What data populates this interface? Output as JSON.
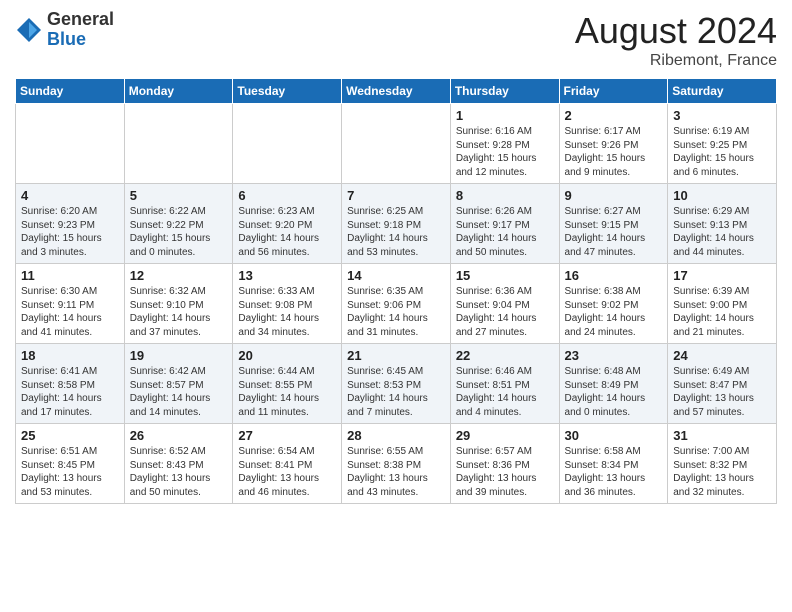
{
  "header": {
    "logo_general": "General",
    "logo_blue": "Blue",
    "month_title": "August 2024",
    "location": "Ribemont, France"
  },
  "weekdays": [
    "Sunday",
    "Monday",
    "Tuesday",
    "Wednesday",
    "Thursday",
    "Friday",
    "Saturday"
  ],
  "weeks": [
    [
      {
        "day": "",
        "info": ""
      },
      {
        "day": "",
        "info": ""
      },
      {
        "day": "",
        "info": ""
      },
      {
        "day": "",
        "info": ""
      },
      {
        "day": "1",
        "info": "Sunrise: 6:16 AM\nSunset: 9:28 PM\nDaylight: 15 hours\nand 12 minutes."
      },
      {
        "day": "2",
        "info": "Sunrise: 6:17 AM\nSunset: 9:26 PM\nDaylight: 15 hours\nand 9 minutes."
      },
      {
        "day": "3",
        "info": "Sunrise: 6:19 AM\nSunset: 9:25 PM\nDaylight: 15 hours\nand 6 minutes."
      }
    ],
    [
      {
        "day": "4",
        "info": "Sunrise: 6:20 AM\nSunset: 9:23 PM\nDaylight: 15 hours\nand 3 minutes."
      },
      {
        "day": "5",
        "info": "Sunrise: 6:22 AM\nSunset: 9:22 PM\nDaylight: 15 hours\nand 0 minutes."
      },
      {
        "day": "6",
        "info": "Sunrise: 6:23 AM\nSunset: 9:20 PM\nDaylight: 14 hours\nand 56 minutes."
      },
      {
        "day": "7",
        "info": "Sunrise: 6:25 AM\nSunset: 9:18 PM\nDaylight: 14 hours\nand 53 minutes."
      },
      {
        "day": "8",
        "info": "Sunrise: 6:26 AM\nSunset: 9:17 PM\nDaylight: 14 hours\nand 50 minutes."
      },
      {
        "day": "9",
        "info": "Sunrise: 6:27 AM\nSunset: 9:15 PM\nDaylight: 14 hours\nand 47 minutes."
      },
      {
        "day": "10",
        "info": "Sunrise: 6:29 AM\nSunset: 9:13 PM\nDaylight: 14 hours\nand 44 minutes."
      }
    ],
    [
      {
        "day": "11",
        "info": "Sunrise: 6:30 AM\nSunset: 9:11 PM\nDaylight: 14 hours\nand 41 minutes."
      },
      {
        "day": "12",
        "info": "Sunrise: 6:32 AM\nSunset: 9:10 PM\nDaylight: 14 hours\nand 37 minutes."
      },
      {
        "day": "13",
        "info": "Sunrise: 6:33 AM\nSunset: 9:08 PM\nDaylight: 14 hours\nand 34 minutes."
      },
      {
        "day": "14",
        "info": "Sunrise: 6:35 AM\nSunset: 9:06 PM\nDaylight: 14 hours\nand 31 minutes."
      },
      {
        "day": "15",
        "info": "Sunrise: 6:36 AM\nSunset: 9:04 PM\nDaylight: 14 hours\nand 27 minutes."
      },
      {
        "day": "16",
        "info": "Sunrise: 6:38 AM\nSunset: 9:02 PM\nDaylight: 14 hours\nand 24 minutes."
      },
      {
        "day": "17",
        "info": "Sunrise: 6:39 AM\nSunset: 9:00 PM\nDaylight: 14 hours\nand 21 minutes."
      }
    ],
    [
      {
        "day": "18",
        "info": "Sunrise: 6:41 AM\nSunset: 8:58 PM\nDaylight: 14 hours\nand 17 minutes."
      },
      {
        "day": "19",
        "info": "Sunrise: 6:42 AM\nSunset: 8:57 PM\nDaylight: 14 hours\nand 14 minutes."
      },
      {
        "day": "20",
        "info": "Sunrise: 6:44 AM\nSunset: 8:55 PM\nDaylight: 14 hours\nand 11 minutes."
      },
      {
        "day": "21",
        "info": "Sunrise: 6:45 AM\nSunset: 8:53 PM\nDaylight: 14 hours\nand 7 minutes."
      },
      {
        "day": "22",
        "info": "Sunrise: 6:46 AM\nSunset: 8:51 PM\nDaylight: 14 hours\nand 4 minutes."
      },
      {
        "day": "23",
        "info": "Sunrise: 6:48 AM\nSunset: 8:49 PM\nDaylight: 14 hours\nand 0 minutes."
      },
      {
        "day": "24",
        "info": "Sunrise: 6:49 AM\nSunset: 8:47 PM\nDaylight: 13 hours\nand 57 minutes."
      }
    ],
    [
      {
        "day": "25",
        "info": "Sunrise: 6:51 AM\nSunset: 8:45 PM\nDaylight: 13 hours\nand 53 minutes."
      },
      {
        "day": "26",
        "info": "Sunrise: 6:52 AM\nSunset: 8:43 PM\nDaylight: 13 hours\nand 50 minutes."
      },
      {
        "day": "27",
        "info": "Sunrise: 6:54 AM\nSunset: 8:41 PM\nDaylight: 13 hours\nand 46 minutes."
      },
      {
        "day": "28",
        "info": "Sunrise: 6:55 AM\nSunset: 8:38 PM\nDaylight: 13 hours\nand 43 minutes."
      },
      {
        "day": "29",
        "info": "Sunrise: 6:57 AM\nSunset: 8:36 PM\nDaylight: 13 hours\nand 39 minutes."
      },
      {
        "day": "30",
        "info": "Sunrise: 6:58 AM\nSunset: 8:34 PM\nDaylight: 13 hours\nand 36 minutes."
      },
      {
        "day": "31",
        "info": "Sunrise: 7:00 AM\nSunset: 8:32 PM\nDaylight: 13 hours\nand 32 minutes."
      }
    ]
  ]
}
